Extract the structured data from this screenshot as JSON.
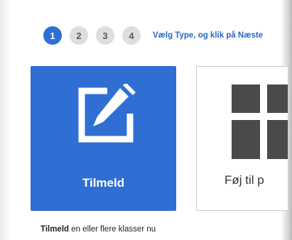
{
  "steps": [
    {
      "label": "1",
      "active": true
    },
    {
      "label": "2",
      "active": false
    },
    {
      "label": "3",
      "active": false
    },
    {
      "label": "4",
      "active": false
    }
  ],
  "instruction": "Vælg Type, og klik på Næste",
  "cards": {
    "enroll": {
      "label": "Tilmeld",
      "icon": "edit-icon",
      "color": "#2f6fd4"
    },
    "add": {
      "label": "Føj til p",
      "icon": "grid-icon"
    }
  },
  "description": {
    "bold": "Tilmeld",
    "rest": " en eller flere klasser nu"
  },
  "colors": {
    "accent": "#2f6fd4",
    "link": "#2a67c8",
    "step_inactive": "#dedede"
  }
}
